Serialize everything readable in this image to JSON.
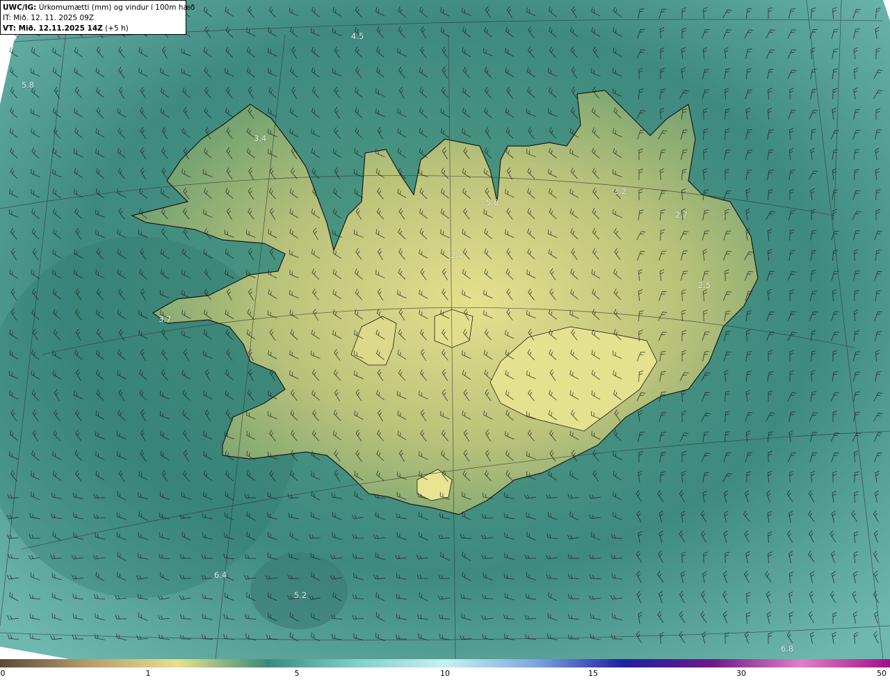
{
  "header": {
    "title_bold": "UWC/IG:",
    "title_rest": " Úrkomumætti (mm) og vindur í 100m hæð",
    "it_line": "IT: Mið. 12. 11. 2025 09Z",
    "vt_bold": "VT: Mið. 12.11.2025 14Z",
    "vt_rest": " (+5 h)"
  },
  "value_labels": [
    "4.5",
    "5.8",
    "3.4",
    "5.8",
    "3.2",
    "2.7",
    "2.5",
    "3.7",
    "2.4",
    "6.4",
    "5.2",
    "6.8"
  ],
  "colorbar": {
    "ticks": [
      "0",
      "1",
      "5",
      "10",
      "15",
      "30",
      "50"
    ],
    "stops": [
      "#5a4a3a",
      "#b89c6e",
      "#e8e08c",
      "#3a8a78",
      "#7fd0cc",
      "#c8f0f0",
      "#80a8e0",
      "#2020a0",
      "#6a1a8a",
      "#e080c8",
      "#a0108a"
    ]
  },
  "colors": {
    "sea": "#3f8a80",
    "land": "#c8c878",
    "coast": "#1a1a1a"
  }
}
